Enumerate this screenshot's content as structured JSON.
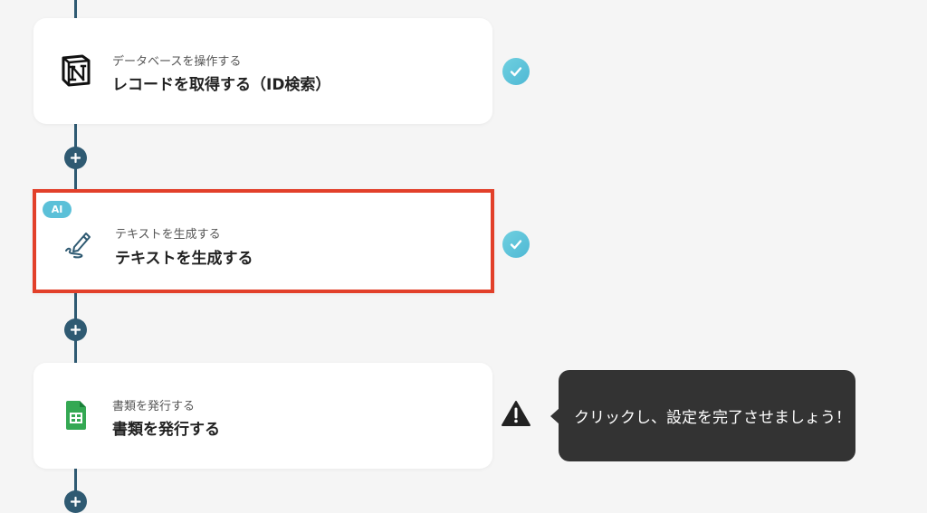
{
  "steps": [
    {
      "subtitle": "データベースを操作する",
      "title": "レコードを取得する（ID検索）",
      "icon": "notion-icon",
      "status": "completed"
    },
    {
      "badge": "AI",
      "subtitle": "テキストを生成する",
      "title": "テキストを生成する",
      "icon": "pen-icon",
      "status": "completed",
      "highlighted": true
    },
    {
      "subtitle": "書類を発行する",
      "title": "書類を発行する",
      "icon": "google-sheets-icon",
      "status": "warning"
    }
  ],
  "tooltip": {
    "text": "クリックし、設定を完了させましょう！"
  },
  "colors": {
    "flow_line": "#2f5a72",
    "highlight_border": "#e2402a",
    "check": "#4fb8d4",
    "tooltip_bg": "#333333",
    "ai_badge": "#5bc0d8",
    "sheets_green": "#34a853"
  }
}
